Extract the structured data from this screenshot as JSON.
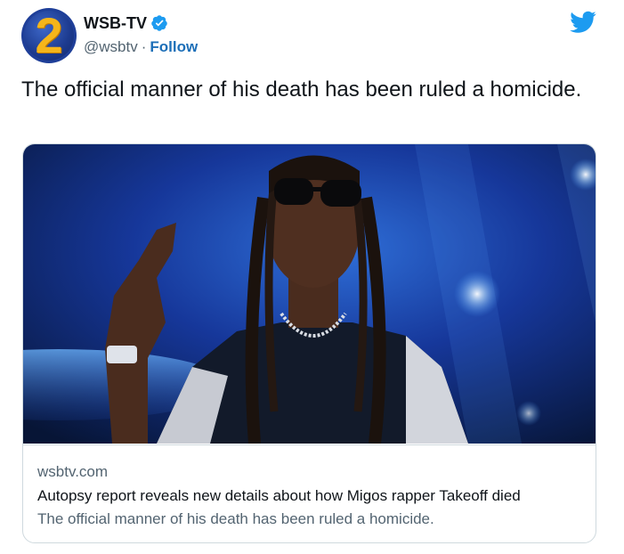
{
  "account": {
    "avatar_text": "2",
    "display_name": "WSB-TV",
    "handle": "@wsbtv",
    "separator": "·",
    "follow_label": "Follow"
  },
  "tweet": {
    "text": "The official manner of his death has been ruled a homicide."
  },
  "card": {
    "domain": "wsbtv.com",
    "title": "Autopsy report reveals new details about how Migos rapper Takeoff died",
    "description": "The official manner of his death has been ruled a homicide."
  },
  "colors": {
    "twitter_blue": "#1d9bf0",
    "follow_blue": "#1d6fb8",
    "avatar_yellow": "#f5b51a",
    "avatar_navy": "#1f3f99",
    "secondary_text": "#536471"
  },
  "icons": {
    "verified": "verified-badge-icon",
    "brand": "twitter-bird-icon"
  }
}
